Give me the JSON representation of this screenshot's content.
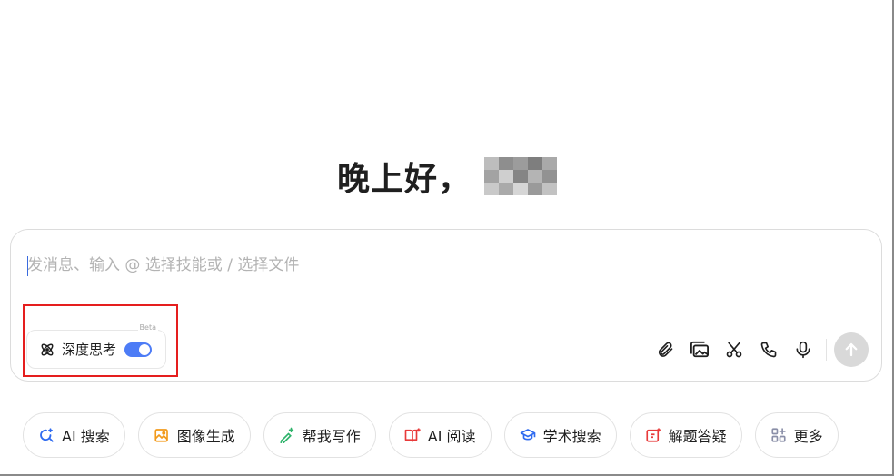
{
  "greeting": {
    "text": "晚上好，",
    "username_redacted": true
  },
  "chat": {
    "placeholder": "发消息、输入 @ 选择技能或 / 选择文件",
    "deep_think": {
      "label": "深度思考",
      "badge": "Beta",
      "enabled": true
    },
    "tools": [
      {
        "icon": "paperclip-icon",
        "name": "attach"
      },
      {
        "icon": "image-icon",
        "name": "image"
      },
      {
        "icon": "scissors-icon",
        "name": "screenshot"
      },
      {
        "icon": "phone-icon",
        "name": "call"
      },
      {
        "icon": "microphone-icon",
        "name": "voice"
      }
    ],
    "send_icon": "arrow-up-icon"
  },
  "quick_actions": [
    {
      "label": "AI 搜索",
      "icon": "ai-search-icon",
      "color": "#2f6bf0"
    },
    {
      "label": "图像生成",
      "icon": "image-generate-icon",
      "color": "#f29a1a"
    },
    {
      "label": "帮我写作",
      "icon": "pen-sparkle-icon",
      "color": "#2fb36b"
    },
    {
      "label": "AI 阅读",
      "icon": "book-icon",
      "color": "#e83a3a"
    },
    {
      "label": "学术搜索",
      "icon": "graduation-cap-icon",
      "color": "#2f6bf0"
    },
    {
      "label": "解题答疑",
      "icon": "question-board-icon",
      "color": "#e83a3a"
    },
    {
      "label": "更多",
      "icon": "grid-icon",
      "color": "#8a8fa8"
    }
  ],
  "colors": {
    "accent": "#4d7cf6",
    "highlight": "#e51e1e"
  }
}
